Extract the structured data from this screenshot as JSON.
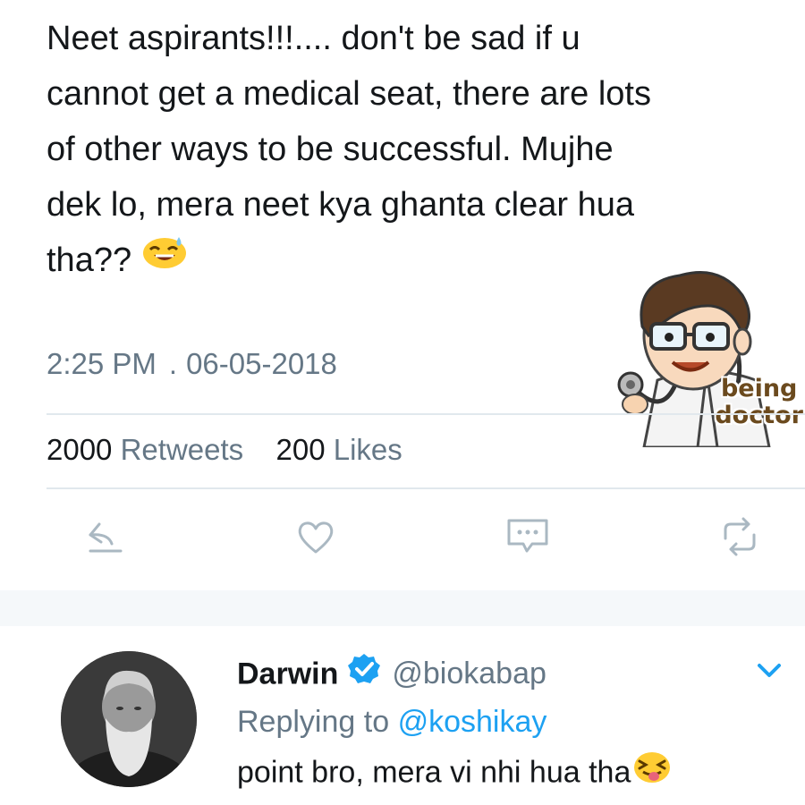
{
  "tweet": {
    "lines": [
      "Neet aspirants!!!.... don't be sad if u",
      "cannot get a medical seat, there are lots",
      "of other ways to be successful.   Mujhe",
      "dek lo, mera neet kya ghanta clear hua",
      "tha??"
    ],
    "emoji_icon": "grinning-sweat-emoji",
    "time": "2:25 PM",
    "separator": ".",
    "date": "06-05-2018",
    "retweets_count": "2000",
    "retweets_label": "Retweets",
    "likes_count": "200",
    "likes_label": "Likes"
  },
  "sticker": {
    "line1": "being",
    "line2": "doctor",
    "icon": "cartoon-doctor-sticker"
  },
  "actions": [
    {
      "name": "reply-icon"
    },
    {
      "name": "heart-icon"
    },
    {
      "name": "direct-message-icon"
    },
    {
      "name": "retweet-icon"
    }
  ],
  "reply": {
    "name": "Darwin",
    "handle": "@biokabap",
    "replying_prefix": "Replying to",
    "replying_handle": "@koshikay",
    "text": "point bro, mera vi nhi hua tha",
    "emoji_icon": "squinting-tongue-emoji",
    "avatar_icon": "bearded-man-portrait",
    "verified_icon": "verified-badge-icon",
    "menu_icon": "chevron-down-icon"
  },
  "colors": {
    "link_blue": "#1da1f2",
    "muted_gray": "#657786",
    "text_dark": "#14171a",
    "emoji_yellow": "#ffcc33"
  }
}
